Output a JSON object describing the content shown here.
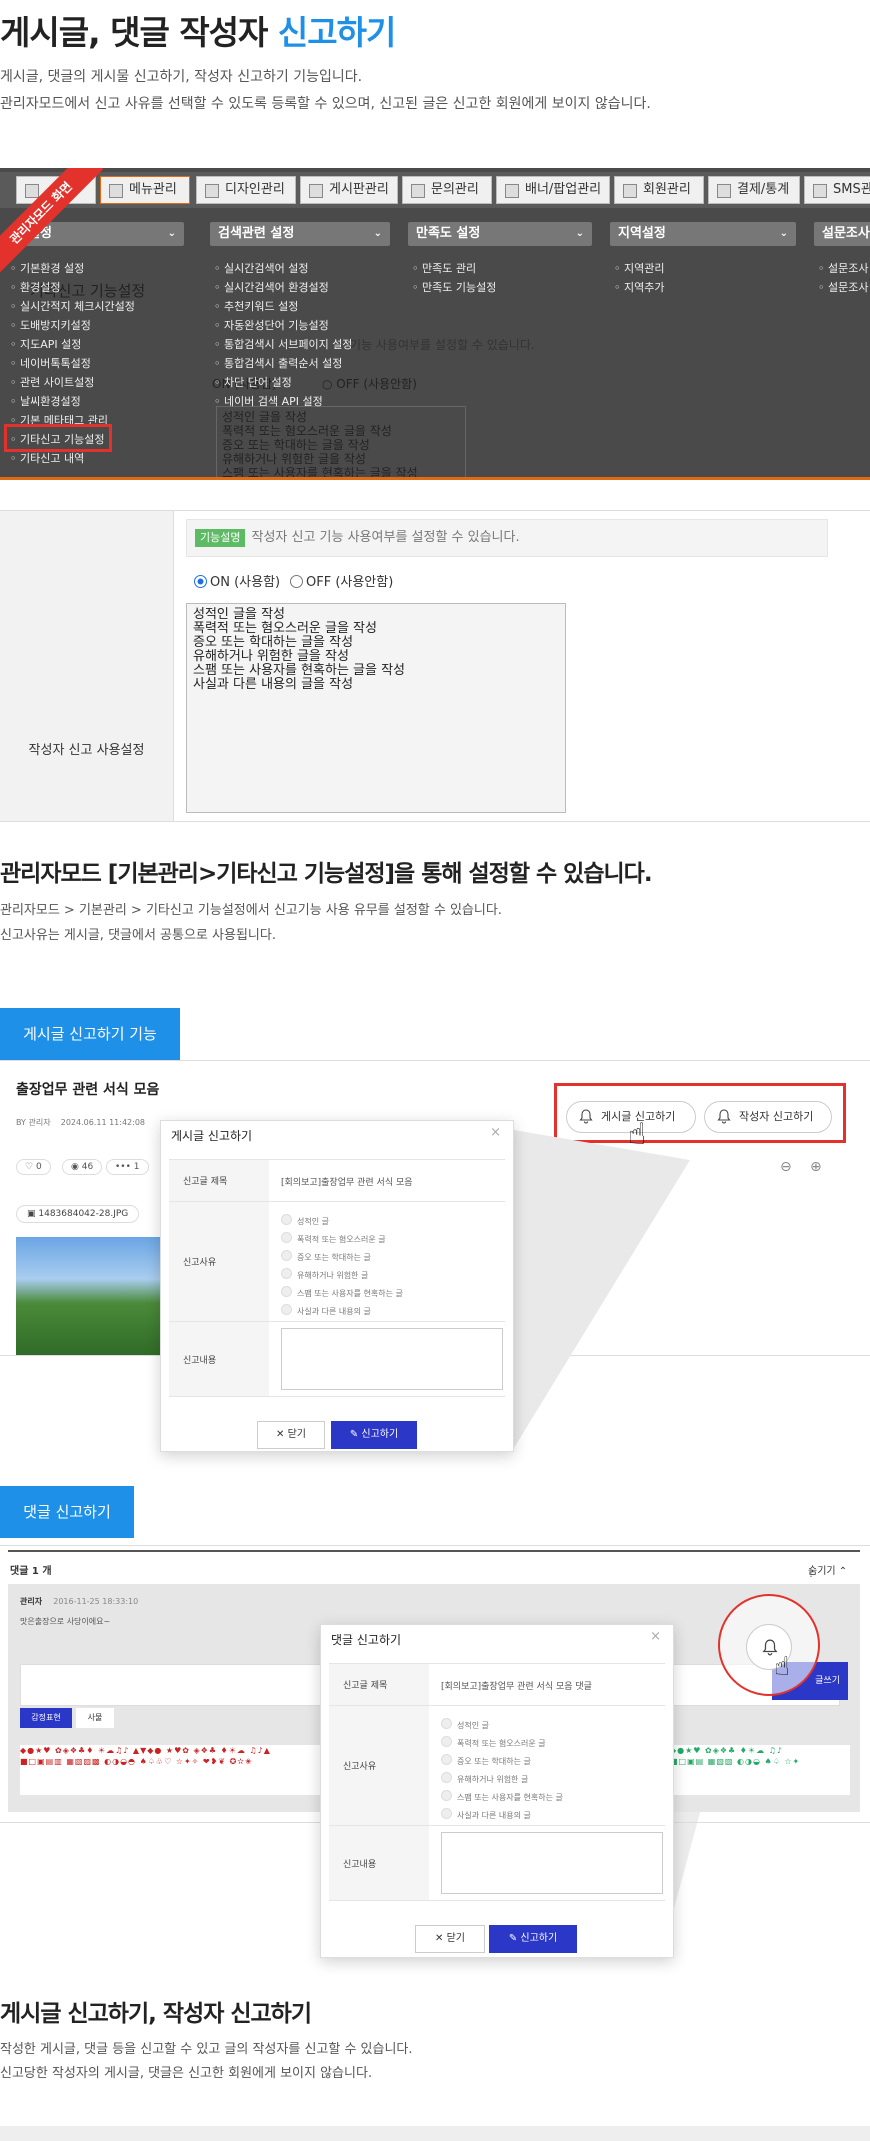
{
  "header": {
    "title_part1": "게시글, 댓글 작성자 ",
    "title_accent": "신고하기",
    "desc_line1": "게시글, 댓글의 게시물 신고하기, 작성자 신고하기 기능입니다.",
    "desc_line2": "관리자모드에서 신고 사유를 선택할 수 있도록 등록할 수 있으며, 신고된 글은 신고한 회원에게 보이지 않습니다."
  },
  "admin_screenshot": {
    "ribbon": "관리자모드 화면",
    "tabs": [
      "메뉴관리",
      "디자인관리",
      "게시판관리",
      "문의관리",
      "배너/팝업관리",
      "회원관리",
      "결제/통계",
      "SMS관"
    ],
    "dropdowns": [
      "설정",
      "검색관련 설정",
      "만족도 설정",
      "지역설정",
      "설문조사"
    ],
    "col1": [
      "기본환경 설정",
      "환경설정",
      "실시간적지 체크시간설정",
      "도배방지키설정",
      "지도API 설정",
      "네이버톡톡설정",
      "관련 사이트설정",
      "날씨환경설정",
      "기본 메타태그 관리",
      "기타신고 기능설정",
      "기타신고 내역"
    ],
    "col2": [
      "실시간검색어 설정",
      "실시간검색어 환경설정",
      "추천키워드 설정",
      "자동완성단어 기능설정",
      "통합검색시 서브페이지 설정",
      "통합검색시 출력순서 설정",
      "차단 단어 설정",
      "네이버 검색 API 설정"
    ],
    "col3": [
      "만족도 관리",
      "만족도 기능설정"
    ],
    "col4": [
      "지역관리",
      "지역추가"
    ],
    "col5": [
      "설문조사",
      "설문조사"
    ],
    "ghost_title": "기타신고 기능설정",
    "ghost_desc": "기능 사용여부를 설정할 수 있습니다.",
    "ghost_on": "ON (사용함)",
    "ghost_off": "OFF (사용안함)",
    "ghost_lines": [
      "성적인 글을 작성",
      "폭력적 또는 혐오스러운 글을 작성",
      "증오 또는 학대하는 글을 작성",
      "유해하거나 위험한 글을 작성",
      "스팸 또는 사용자를 현혹하는 글을 작성"
    ]
  },
  "settings": {
    "label": "작성자 신고 사용설정",
    "badge": "기능설명",
    "note": "작성자 신고 기능 사용여부를 설정할 수 있습니다.",
    "on_label": "ON (사용함)",
    "off_label": "OFF (사용안함)",
    "reasons_text": "성적인 글을 작성\n폭력적 또는 혐오스러운 글을 작성\n증오 또는 학대하는 글을 작성\n유해하거나 위험한 글을 작성\n스팸 또는 사용자를 현혹하는 글을 작성\n사실과 다른 내용의 글을 작성"
  },
  "section1": {
    "title": "관리자모드 [기본관리>기타신고 기능설정]을 통해 설정할 수 있습니다.",
    "desc_line1": "관리자모드 > 기본관리 > 기타신고 기능설정에서 신고기능 사용 유무를 설정할 수 있습니다.",
    "desc_line2": "신고사유는 게시글, 댓글에서 공통으로 사용됩니다."
  },
  "post_section": {
    "badge": "게시글 신고하기 기능",
    "post_title": "출장업무 관련 서식 모음",
    "byline": "BY 관리자",
    "date": "2024.06.11 11:42:08",
    "likes": "0",
    "views": "46",
    "more": "1",
    "attachment": "1483684042-28.JPG",
    "report_post_btn": "게시글 신고하기",
    "report_author_btn": "작성자 신고하기",
    "modal": {
      "title": "게시글 신고하기",
      "close_x": "×",
      "label_subject": "신고글 제목",
      "subject_value": "[회의보고]출장업무 관련 서식 모음",
      "label_reason": "신고사유",
      "reasons": [
        "성적인 글",
        "폭력적 또는 혐오스러운 글",
        "증오 또는 학대하는 글",
        "유해하거나 위험한 글",
        "스팸 또는 사용자를 현혹하는 글",
        "사실과 다른 내용의 글"
      ],
      "label_content": "신고내용",
      "btn_close": "닫기",
      "btn_report": "신고하기"
    }
  },
  "comment_section": {
    "badge": "댓글 신고하기",
    "count_label": "댓글 1 개",
    "hide_label": "숨기기",
    "author": "관리자",
    "date": "2016-11-25 18:33:10",
    "text": "맛은출장으로 사당이에요~",
    "tab1": "감정표현",
    "tab2": "사물",
    "write_btn": "글쓰기",
    "modal": {
      "title": "댓글 신고하기",
      "close_x": "×",
      "label_subject": "신고글 제목",
      "subject_value": "[회의보고]출장업무 관련 서식 모음 댓글",
      "label_reason": "신고사유",
      "reasons": [
        "성적인 글",
        "폭력적 또는 혐오스러운 글",
        "증오 또는 학대하는 글",
        "유해하거나 위험한 글",
        "스팸 또는 사용자를 현혹하는 글",
        "사실과 다른 내용의 글"
      ],
      "label_content": "신고내용",
      "btn_close": "닫기",
      "btn_report": "신고하기"
    }
  },
  "section2": {
    "title": "게시글 신고하기, 작성자 신고하기",
    "desc_line1": "작성한 게시글, 댓글 등을 신고할 수 있고 글의 작성자를 신고할 수 있습니다.",
    "desc_line2": "신고당한 작성자의 게시글, 댓글은 신고한 회원에게 보이지 않습니다."
  },
  "colors": {
    "accent": "#1e90e8",
    "report_button": "#2a37c7",
    "highlight_red": "#e2322b"
  }
}
